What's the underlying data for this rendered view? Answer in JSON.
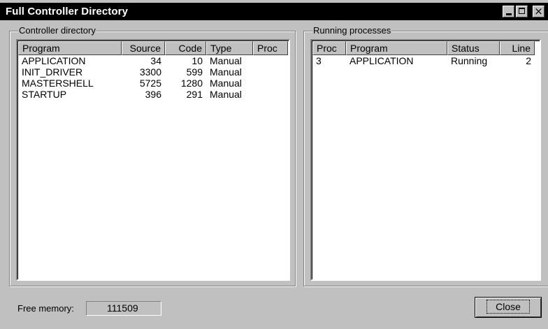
{
  "window": {
    "title": "Full Controller Directory"
  },
  "controller_directory": {
    "group_label": "Controller directory",
    "columns": [
      "Program",
      "Source",
      "Code",
      "Type",
      "Proc"
    ],
    "rows": [
      {
        "program": "APPLICATION",
        "source": "34",
        "code": "10",
        "type": "Manual",
        "proc": ""
      },
      {
        "program": "INIT_DRIVER",
        "source": "3300",
        "code": "599",
        "type": "Manual",
        "proc": ""
      },
      {
        "program": "MASTERSHELL",
        "source": "5725",
        "code": "1280",
        "type": "Manual",
        "proc": ""
      },
      {
        "program": "STARTUP",
        "source": "396",
        "code": "291",
        "type": "Manual",
        "proc": ""
      }
    ]
  },
  "running_processes": {
    "group_label": "Running processes",
    "columns": [
      "Proc",
      "Program",
      "Status",
      "Line"
    ],
    "rows": [
      {
        "proc": "3",
        "program": "APPLICATION",
        "status": "Running",
        "line": "2"
      }
    ]
  },
  "footer": {
    "free_memory_label": "Free memory:",
    "free_memory_value": "111509",
    "close_button_label": "Close"
  }
}
